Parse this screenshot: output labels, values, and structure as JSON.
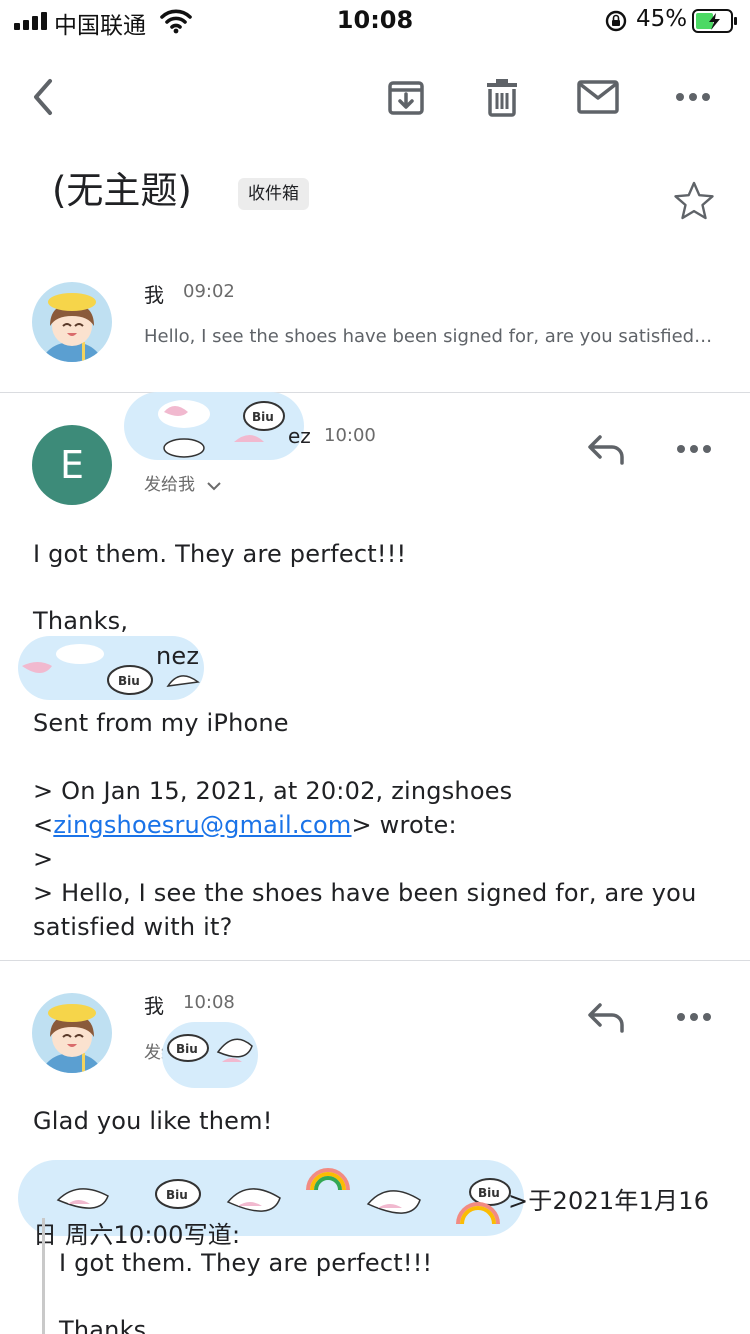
{
  "status_bar": {
    "carrier": "中国联通",
    "time": "10:08",
    "battery_percent": "45%"
  },
  "toolbar": {
    "back_icon": "chevron-left-icon",
    "archive_icon": "archive-icon",
    "delete_icon": "trash-icon",
    "mark_unread_icon": "mail-icon",
    "more_icon": "more-horizontal-icon"
  },
  "thread": {
    "subject": "(无主题)",
    "folder_label": "收件箱",
    "star_icon": "star-outline-icon"
  },
  "messages": [
    {
      "sender": "我",
      "time": "09:02",
      "snippet": "Hello, I see the shoes have been signed for, are you satisfied…",
      "collapsed": true
    },
    {
      "avatar_letter": "E",
      "sender": "ez",
      "time": "10:00",
      "recipient": "发给我",
      "body": {
        "line1": "I got them. They are perfect!!!",
        "line2": "Thanks,",
        "line3": "nez",
        "line4": "Sent from my iPhone",
        "line5": "> On Jan 15, 2021, at 20:02, zingshoes",
        "line6_prefix": "<",
        "line6_link": "zingshoesru@gmail.com",
        "line6_suffix": "> wrote:",
        "line7": ">",
        "line8": "> Hello, I see the shoes have been signed for, are you",
        "line9": "satisfied with it?"
      }
    },
    {
      "sender": "我",
      "time": "10:08",
      "recipient": "发给",
      "body": {
        "line1": "Glad you like them!",
        "line2": ">于2021年1月16",
        "line3": "日 周六10:00写道:",
        "quote1": "I got them. They are perfect!!!",
        "quote2": "Thanks,"
      }
    }
  ],
  "colors": {
    "accent_green": "#3d8b79",
    "link_blue": "#1a73e8",
    "icon_gray": "#5f6368"
  }
}
